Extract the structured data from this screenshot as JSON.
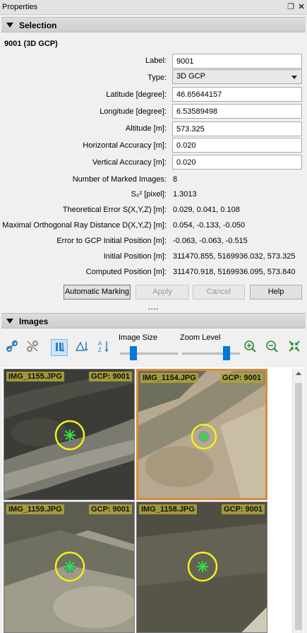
{
  "window": {
    "title": "Properties",
    "float_icon": "restore-icon",
    "close_icon": "close-icon"
  },
  "selection": {
    "header": "Selection",
    "point_title": "9001 (3D GCP)",
    "fields": [
      {
        "label": "Label:",
        "value": "9001"
      },
      {
        "label": "Type:",
        "value": "3D GCP"
      },
      {
        "label": "Latitude [degree]:",
        "value": "46.65644157"
      },
      {
        "label": "Longitude [degree]:",
        "value": "6.53589498"
      },
      {
        "label": "Altitude [m]:",
        "value": "573.325"
      },
      {
        "label": "Horizontal Accuracy [m]:",
        "value": "0.020"
      },
      {
        "label": "Vertical Accuracy [m]:",
        "value": "0.020"
      }
    ],
    "stats": [
      {
        "label": "Number of Marked Images:",
        "value": "8"
      },
      {
        "label": "S₀² [pixel]:",
        "value": "1.3013"
      },
      {
        "label": "Theoretical Error S(X,Y,Z) [m]:",
        "value": "0.029, 0.041, 0.108"
      },
      {
        "label": "Maximal Orthogonal Ray Distance D(X,Y,Z) [m]:",
        "value": "0.054, -0.133, -0.050"
      },
      {
        "label": "Error to GCP Initial Position [m]:",
        "value": "-0.063, -0.063, -0.515"
      },
      {
        "label": "Initial Position [m]:",
        "value": "311470.855, 5169936.032, 573.325"
      },
      {
        "label": "Computed Position [m]:",
        "value": "311470.918, 5169936.095, 573.840"
      }
    ],
    "buttons": {
      "automatic_marking": "Automatic Marking",
      "apply": "Apply",
      "cancel": "Cancel",
      "help": "Help"
    }
  },
  "images": {
    "header": "Images",
    "toolbar": {
      "icons": [
        "link-icon",
        "unlink-icon",
        "sort-columns-icon",
        "sort-triangle-icon",
        "sort-az-icon",
        "zoom-in-icon",
        "zoom-out-icon",
        "fit-icon"
      ],
      "image_size_label": "Image Size",
      "zoom_level_label": "Zoom Level",
      "image_size_value": 0.2,
      "zoom_level_value": 0.8
    },
    "thumbnails": [
      {
        "name": "IMG_1155.JPG",
        "gcp": "GCP: 9001",
        "selected": false
      },
      {
        "name": "IMG_1154.JPG",
        "gcp": "GCP: 9001",
        "selected": true
      },
      {
        "name": "IMG_1159.JPG",
        "gcp": "GCP: 9001",
        "selected": false
      },
      {
        "name": "IMG_1158.JPG",
        "gcp": "GCP: 9001",
        "selected": false
      }
    ]
  },
  "colors": {
    "accent": "#0078d7",
    "selected_border": "#d68d3c",
    "label_bg": "#ada33a",
    "marker_ring": "#f2f21a",
    "marker_cross": "#33dd44"
  }
}
